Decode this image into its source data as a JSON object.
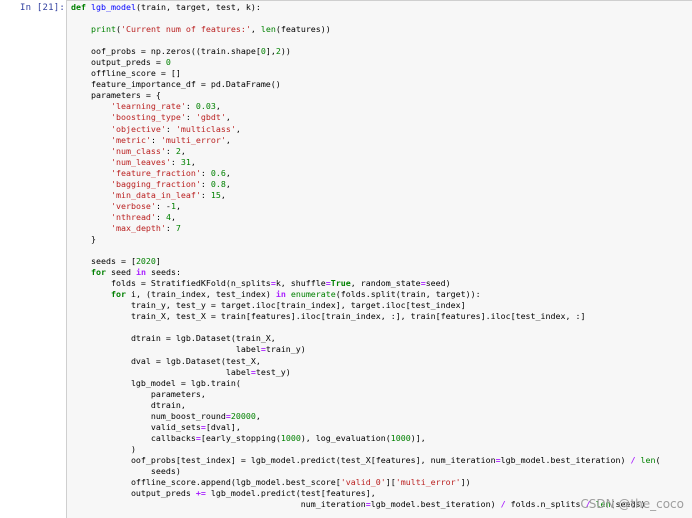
{
  "cell": {
    "prompt": "In  [21]:",
    "lines": [
      "def lgb_model(train, target, test, k):",
      "",
      "    print('Current num of features:', len(features))",
      "",
      "    oof_probs = np.zeros((train.shape[0],2))",
      "    output_preds = 0",
      "    offline_score = []",
      "    feature_importance_df = pd.DataFrame()",
      "    parameters = {",
      "        'learning_rate': 0.03,",
      "        'boosting_type': 'gbdt',",
      "        'objective': 'multiclass',",
      "        'metric': 'multi_error',",
      "        'num_class': 2,",
      "        'num_leaves': 31,",
      "        'feature_fraction': 0.6,",
      "        'bagging_fraction': 0.8,",
      "        'min_data_in_leaf': 15,",
      "        'verbose': -1,",
      "        'nthread': 4,",
      "        'max_depth': 7",
      "    }",
      "",
      "    seeds = [2020]",
      "    for seed in seeds:",
      "        folds = StratifiedKFold(n_splits=k, shuffle=True, random_state=seed)",
      "        for i, (train_index, test_index) in enumerate(folds.split(train, target)):",
      "            train_y, test_y = target.iloc[train_index], target.iloc[test_index]",
      "            train_X, test_X = train[features].iloc[train_index, :], train[features].iloc[test_index, :]",
      "",
      "            dtrain = lgb.Dataset(train_X,",
      "                                 label=train_y)",
      "            dval = lgb.Dataset(test_X,",
      "                               label=test_y)",
      "            lgb_model = lgb.train(",
      "                parameters,",
      "                dtrain,",
      "                num_boost_round=20000,",
      "                valid_sets=[dval],",
      "                callbacks=[early_stopping(1000), log_evaluation(1000)],",
      "            )",
      "            oof_probs[test_index] = lgb_model.predict(test_X[features], num_iteration=lgb_model.best_iteration) / len(",
      "                seeds)",
      "            offline_score.append(lgb_model.best_score['valid_0']['multi_error'])",
      "            output_preds += lgb_model.predict(test[features],",
      "                                              num_iteration=lgb_model.best_iteration) / folds.n_splits / len(seeds)"
    ]
  },
  "watermark": "CSDN @the_coco",
  "colors": {
    "keyword": "#008000",
    "string": "#ba2121",
    "number": "#008000",
    "operator": "#aa22ff",
    "function": "#0000ff",
    "prompt": "#303f9f",
    "background": "#f7f7f7"
  }
}
